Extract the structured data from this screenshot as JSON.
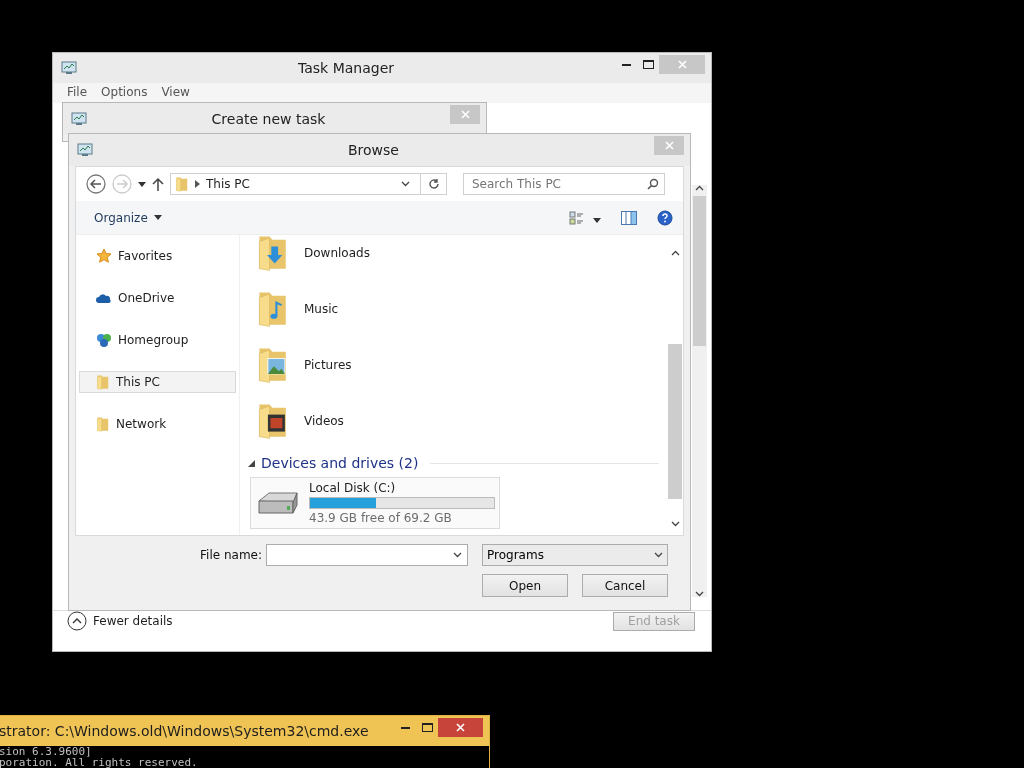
{
  "task_manager": {
    "title": "Task Manager",
    "menu": [
      "File",
      "Options",
      "View"
    ],
    "fewer_details": "Fewer details",
    "end_task": {
      "label": "End task",
      "disabled": true
    }
  },
  "create_task": {
    "title": "Create new task"
  },
  "browse": {
    "title": "Browse",
    "address": "This PC",
    "search": {
      "placeholder": "Search This PC"
    },
    "organize": "Organize",
    "nav": [
      {
        "label": "Favorites",
        "kind": "favorites",
        "selected": false
      },
      {
        "label": "OneDrive",
        "kind": "onedrive",
        "selected": false
      },
      {
        "label": "Homegroup",
        "kind": "homegroup",
        "selected": false
      },
      {
        "label": "This PC",
        "kind": "pc",
        "selected": true
      },
      {
        "label": "Network",
        "kind": "network",
        "selected": false
      }
    ],
    "folders": [
      {
        "name": "Downloads",
        "kind": "downloads"
      },
      {
        "name": "Music",
        "kind": "music"
      },
      {
        "name": "Pictures",
        "kind": "pictures"
      },
      {
        "name": "Videos",
        "kind": "videos"
      }
    ],
    "group": {
      "title": "Devices and drives (2)",
      "expanded": true
    },
    "drive": {
      "name": "Local Disk (C:)",
      "level": 0.36,
      "free": "43.9 GB free of 69.2 GB"
    },
    "file_name_label": "File name:",
    "file_type": "Programs",
    "buttons": [
      "Open",
      "Cancel"
    ]
  },
  "cmd": {
    "title": "strator: C:\\Windows.old\\Windows\\System32\\cmd.exe",
    "lines": [
      "sion 6.3.9600]",
      "poration. All rights reserved."
    ]
  }
}
